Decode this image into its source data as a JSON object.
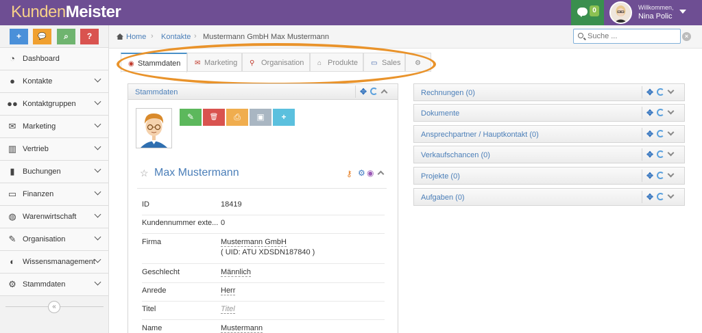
{
  "app": {
    "logo_part1": "Kunden",
    "logo_part2": "Meister",
    "chat_count": "0",
    "welcome_label": "Willkommen,",
    "user_name": "Nina Polic"
  },
  "sidebar": {
    "quick_buttons": [
      {
        "icon": "plus-icon",
        "glyph": "+",
        "color": "#4a90d9"
      },
      {
        "icon": "comments-icon",
        "glyph": "💬",
        "color": "#f0a030"
      },
      {
        "icon": "search-icon",
        "glyph": "⌕",
        "color": "#6fb46f"
      },
      {
        "icon": "help-icon",
        "glyph": "?",
        "color": "#d9534f"
      }
    ],
    "items": [
      {
        "label": "Dashboard",
        "icon": "dashboard-icon",
        "has_chevron": false
      },
      {
        "label": "Kontakte",
        "icon": "user-icon",
        "has_chevron": true
      },
      {
        "label": "Kontaktgruppen",
        "icon": "users-icon",
        "has_chevron": true
      },
      {
        "label": "Marketing",
        "icon": "envelope-icon",
        "has_chevron": true
      },
      {
        "label": "Vertrieb",
        "icon": "bar-chart-icon",
        "has_chevron": true
      },
      {
        "label": "Buchungen",
        "icon": "bookmark-icon",
        "has_chevron": true
      },
      {
        "label": "Finanzen",
        "icon": "money-icon",
        "has_chevron": true
      },
      {
        "label": "Warenwirtschaft",
        "icon": "globe-icon",
        "has_chevron": true
      },
      {
        "label": "Organisation",
        "icon": "edit-icon",
        "has_chevron": true
      },
      {
        "label": "Wissensmanagement",
        "icon": "adjust-icon",
        "has_chevron": true
      },
      {
        "label": "Stammdaten",
        "icon": "cogs-icon",
        "has_chevron": true
      }
    ],
    "collapse_glyph": "«"
  },
  "breadcrumb": {
    "home": "Home",
    "contacts": "Kontakte",
    "current": "Mustermann GmbH Max Mustermann"
  },
  "search": {
    "placeholder": "Suche ...",
    "value": ""
  },
  "tabs": [
    {
      "label": "Stammdaten",
      "icon": "eye-icon",
      "active": true
    },
    {
      "label": "Marketing",
      "icon": "envelope-icon",
      "active": false
    },
    {
      "label": "Organisation",
      "icon": "map-marker-icon",
      "active": false
    },
    {
      "label": "Produkte",
      "icon": "inbox-icon",
      "active": false
    },
    {
      "label": "Sales",
      "icon": "money-icon",
      "active": false
    },
    {
      "label": "",
      "icon": "gear-icon",
      "active": false
    }
  ],
  "main_panel": {
    "title": "Stammdaten",
    "contact_name": "Max Mustermann",
    "action_buttons": [
      {
        "icon": "pencil-icon",
        "glyph": "✎",
        "color": "#5cb85c"
      },
      {
        "icon": "trash-icon",
        "glyph": "🗑",
        "color": "#d9534f"
      },
      {
        "icon": "print-icon",
        "glyph": "⎙",
        "color": "#f0ad4e"
      },
      {
        "icon": "image-icon",
        "glyph": "▣",
        "color": "#a9b6c2"
      },
      {
        "icon": "plus-icon",
        "glyph": "+",
        "color": "#5bc0de"
      }
    ],
    "fields": [
      {
        "label": "ID",
        "value": "18419",
        "style": "plain"
      },
      {
        "label": "Kundennummer exte...",
        "value": "0",
        "style": "plain"
      },
      {
        "label": "Firma",
        "value": "Mustermann GmbH",
        "value2": "( UID: ATU XDSDN187840 )",
        "style": "dash"
      },
      {
        "label": "Geschlecht",
        "value": "Männlich",
        "style": "dash"
      },
      {
        "label": "Anrede",
        "value": "Herr",
        "style": "dash"
      },
      {
        "label": "Titel",
        "value": "Titel",
        "style": "muted"
      },
      {
        "label": "Name",
        "value": "Mustermann",
        "style": "dash"
      }
    ]
  },
  "right_panels": [
    "Rechnungen (0)",
    "Dokumente",
    "Ansprechpartner / Hauptkontakt (0)",
    "Verkaufschancen (0)",
    "Projekte (0)",
    "Aufgaben (0)"
  ],
  "colors": {
    "header": "#6e4e93",
    "accent": "#4a7eb8",
    "highlight": "#e9932b"
  }
}
